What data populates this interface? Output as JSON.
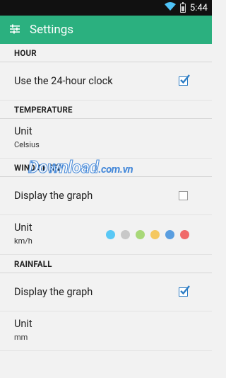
{
  "status_bar": {
    "time": "5:44",
    "icons": [
      "wifi-icon",
      "battery-icon"
    ]
  },
  "app_bar": {
    "title": "Settings",
    "icon": "sliders-icon"
  },
  "sections": {
    "hour": {
      "header": "HOUR",
      "clock_label": "Use the 24-hour clock",
      "clock_checked": true
    },
    "temperature": {
      "header": "TEMPERATURE",
      "unit_label": "Unit",
      "unit_value": "Celsius"
    },
    "wind_speed": {
      "header": "WIND SPEED",
      "graph_label": "Display the graph",
      "graph_checked": false,
      "unit_label": "Unit",
      "unit_value": "km/h"
    },
    "rainfall": {
      "header": "RAINFALL",
      "graph_label": "Display the graph",
      "graph_checked": true,
      "unit_label": "Unit",
      "unit_value": "mm"
    }
  },
  "watermark": {
    "text": "Download",
    "suffix": ".com.vn"
  },
  "watermark_dots": [
    "#5ac8f5",
    "#c8c8c8",
    "#a8d878",
    "#f5c860",
    "#5a9ee0",
    "#f06a6a"
  ],
  "colors": {
    "appbar": "#2bb07f",
    "status_bar": "#111111",
    "background": "#f2f2f2",
    "check": "#2b7cc4"
  }
}
